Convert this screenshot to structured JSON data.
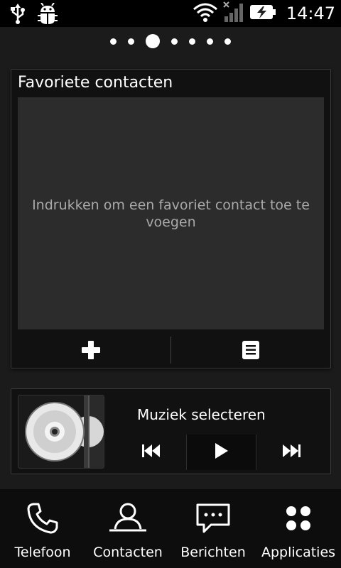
{
  "status_bar": {
    "time": "14:47",
    "icons": [
      "usb-icon",
      "debug-icon",
      "wifi-icon",
      "signal-icon",
      "battery-charging-icon"
    ]
  },
  "pager": {
    "pages": 7,
    "active_index": 2
  },
  "favorites_widget": {
    "title": "Favoriete contacten",
    "hint": "Indrukken om een favoriet contact toe te voegen",
    "actions": [
      "add-icon",
      "list-icon"
    ]
  },
  "music_widget": {
    "title": "Muziek selecteren",
    "controls": [
      "previous-icon",
      "play-icon",
      "next-icon"
    ]
  },
  "bottom_nav": {
    "items": [
      {
        "label": "Telefoon",
        "icon": "phone-icon"
      },
      {
        "label": "Contacten",
        "icon": "contacts-icon"
      },
      {
        "label": "Berichten",
        "icon": "messages-icon"
      },
      {
        "label": "Applicaties",
        "icon": "apps-icon"
      }
    ]
  },
  "colors": {
    "background": "#1b1b1b",
    "widget_panel": "#2c2c2d",
    "hint_text": "#a9a9a9"
  }
}
